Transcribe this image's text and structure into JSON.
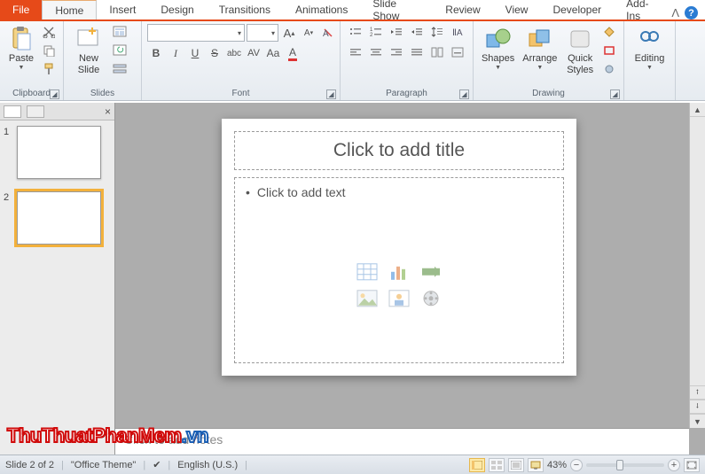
{
  "tabs": {
    "file": "File",
    "items": [
      "Home",
      "Insert",
      "Design",
      "Transitions",
      "Animations",
      "Slide Show",
      "Review",
      "View",
      "Developer",
      "Add-Ins"
    ],
    "active": "Home"
  },
  "ribbon": {
    "clipboard": {
      "label": "Clipboard",
      "paste": "Paste"
    },
    "slides": {
      "label": "Slides",
      "new_slide": "New",
      "new_slide2": "Slide"
    },
    "font": {
      "label": "Font",
      "name_placeholder": "",
      "size_placeholder": ""
    },
    "paragraph": {
      "label": "Paragraph"
    },
    "drawing": {
      "label": "Drawing",
      "shapes": "Shapes",
      "arrange": "Arrange",
      "quick": "Quick",
      "quick2": "Styles"
    },
    "editing": {
      "label": "Editing"
    }
  },
  "thumbs": {
    "items": [
      {
        "num": "1"
      },
      {
        "num": "2"
      }
    ],
    "selected_index": 1
  },
  "slide": {
    "title_placeholder": "Click to add title",
    "body_placeholder": "Click to add text"
  },
  "notes": {
    "placeholder": "Click to add notes"
  },
  "status": {
    "slide_info": "Slide 2 of 2",
    "theme": "\"Office Theme\"",
    "language": "English (U.S.)",
    "zoom": "43%"
  },
  "watermark": {
    "main": "ThuThuatPhanMem",
    "tail": ".vn"
  }
}
